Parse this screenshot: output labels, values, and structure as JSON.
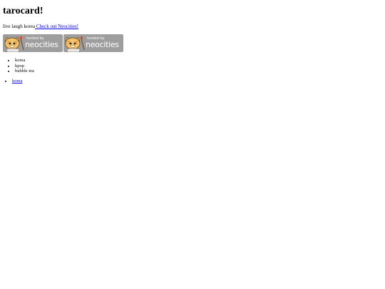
{
  "page": {
    "title": "tarocard!",
    "tagline_text": "live laugh korea",
    "tagline_link": " Check out Neocities!"
  },
  "badges": [
    {
      "hosted": "hosted by",
      "brand": "neocities",
      "icon": "neocities-cat-icon"
    },
    {
      "hosted": "hosted by",
      "brand": "neocities",
      "icon": "neocities-cat-icon"
    }
  ],
  "interests": [
    "korea",
    "kpop",
    "bubble tea"
  ],
  "links": [
    "korea"
  ],
  "colors": {
    "link": "#0000ee",
    "badge_bg": "#9e9e9e"
  }
}
